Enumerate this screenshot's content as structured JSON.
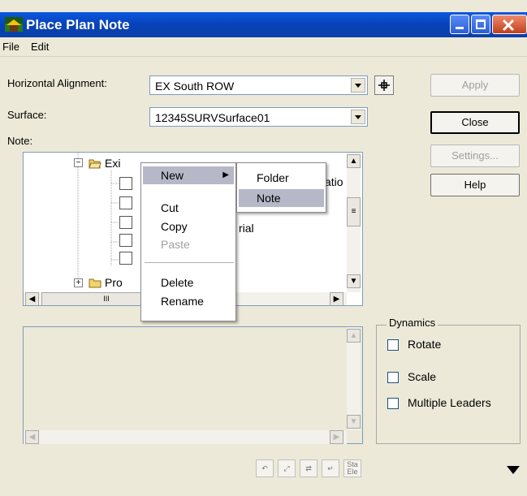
{
  "window": {
    "title": "Place Plan Note"
  },
  "menubar": {
    "items": [
      "File",
      "Edit"
    ]
  },
  "form": {
    "horizontal_alignment_label": "Horizontal Alignment:",
    "horizontal_alignment_value": "EX South ROW",
    "surface_label": "Surface:",
    "surface_value": "12345SURVSurface01",
    "note_label": "Note:"
  },
  "buttons": {
    "apply": "Apply",
    "close": "Close",
    "settings": "Settings...",
    "help": "Help"
  },
  "tree": {
    "existing_label": "Exi",
    "proposed_label": "Pro",
    "partial_text_1": "atio",
    "partial_text_2": "rial",
    "hscroll_thumb": "III"
  },
  "context_menu": {
    "items": [
      "New",
      "Cut",
      "Copy",
      "Paste",
      "Delete",
      "Rename"
    ]
  },
  "submenu": {
    "items": [
      "Folder",
      "Note"
    ]
  },
  "dynamics": {
    "title": "Dynamics",
    "rotate": "Rotate",
    "scale": "Scale",
    "multiple_leaders": "Multiple Leaders"
  },
  "toolbar": {
    "icon_labels": [
      "Sta",
      "Ele"
    ]
  }
}
